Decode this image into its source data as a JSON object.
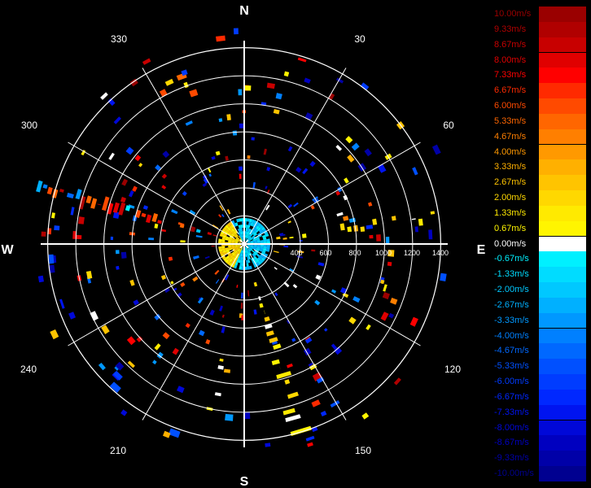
{
  "cardinals": {
    "n": "N",
    "e": "E",
    "s": "S",
    "w": "W"
  },
  "bearings": [
    "30",
    "60",
    "120",
    "150",
    "210",
    "240",
    "300",
    "330"
  ],
  "range_ticks": [
    "400",
    "600",
    "800",
    "1000",
    "1200",
    "1400"
  ],
  "range_max": 1450,
  "colorbar": {
    "levels": [
      {
        "label": "10.00m/s",
        "color": "#9a0000"
      },
      {
        "label": "9.33m/s",
        "color": "#b00000"
      },
      {
        "label": "8.67m/s",
        "color": "#c80000"
      },
      {
        "label": "8.00m/s",
        "color": "#e00000"
      },
      {
        "label": "7.33m/s",
        "color": "#ff0000"
      },
      {
        "label": "6.67m/s",
        "color": "#ff2a00"
      },
      {
        "label": "6.00m/s",
        "color": "#ff4a00"
      },
      {
        "label": "5.33m/s",
        "color": "#ff6600"
      },
      {
        "label": "4.67m/s",
        "color": "#ff7f00"
      },
      {
        "label": "4.00m/s",
        "color": "#ff9900"
      },
      {
        "label": "3.33m/s",
        "color": "#ffb000"
      },
      {
        "label": "2.67m/s",
        "color": "#ffc400"
      },
      {
        "label": "2.00m/s",
        "color": "#ffd800"
      },
      {
        "label": "1.33m/s",
        "color": "#ffea00"
      },
      {
        "label": "0.67m/s",
        "color": "#fff500"
      },
      {
        "label": "0.00m/s",
        "color": "#ffffff"
      },
      {
        "label": "-0.67m/s",
        "color": "#00f0ff"
      },
      {
        "label": "-1.33m/s",
        "color": "#00dcff"
      },
      {
        "label": "-2.00m/s",
        "color": "#00c8ff"
      },
      {
        "label": "-2.67m/s",
        "color": "#00b0ff"
      },
      {
        "label": "-3.33m/s",
        "color": "#0098ff"
      },
      {
        "label": "-4.00m/s",
        "color": "#0080ff"
      },
      {
        "label": "-4.67m/s",
        "color": "#0068ff"
      },
      {
        "label": "-5.33m/s",
        "color": "#0050ff"
      },
      {
        "label": "-6.00m/s",
        "color": "#003cff"
      },
      {
        "label": "-6.67m/s",
        "color": "#0028ff"
      },
      {
        "label": "-7.33m/s",
        "color": "#0014f0"
      },
      {
        "label": "-8.00m/s",
        "color": "#0008d8"
      },
      {
        "label": "-8.67m/s",
        "color": "#0000c0"
      },
      {
        "label": "-9.33m/s",
        "color": "#0000a8"
      },
      {
        "label": "-10.00m/s",
        "color": "#000090"
      }
    ]
  }
}
